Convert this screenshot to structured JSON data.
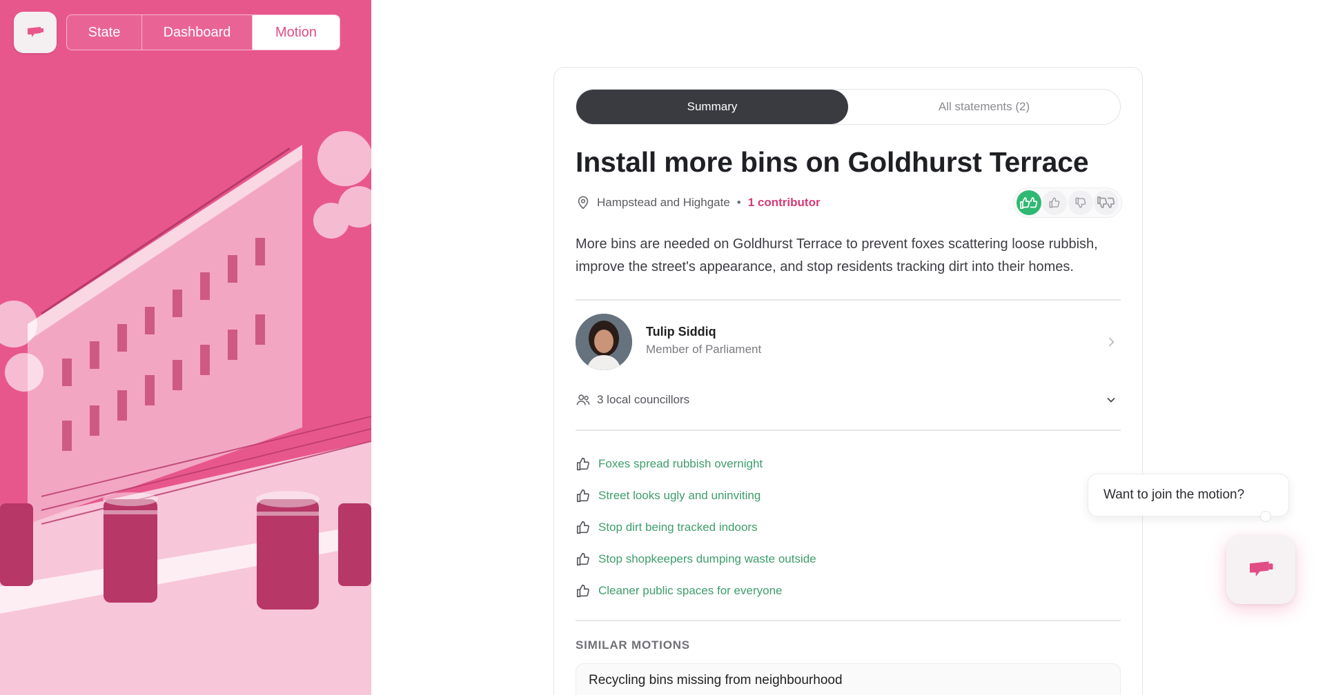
{
  "app": {
    "logo_icon": "flag-megaphone-icon",
    "accent": "#e8578c",
    "accent_dark": "#d63a77",
    "success": "#2fb872"
  },
  "nav": {
    "tabs": [
      {
        "label": "State"
      },
      {
        "label": "Dashboard"
      },
      {
        "label": "Motion",
        "active": true
      }
    ]
  },
  "segment": {
    "summary": "Summary",
    "all_statements": "All statements (2)",
    "active": "Summary"
  },
  "motion": {
    "title": "Install more bins on Goldhurst Terrace",
    "location": "Hampstead and Highgate",
    "separator": "•",
    "contributors": "1 contributor",
    "description": "More bins are needed on Goldhurst Terrace to prevent foxes scattering loose rubbish, improve the street's appearance, and stop residents tracking dirt into their homes.",
    "votes": [
      {
        "icon": "double-thumbs-up-icon",
        "selected": true
      },
      {
        "icon": "thumbs-up-icon",
        "selected": false
      },
      {
        "icon": "thumbs-down-icon",
        "selected": false
      },
      {
        "icon": "double-thumbs-down-icon",
        "selected": false
      }
    ]
  },
  "representative": {
    "name": "Tulip Siddiq",
    "role": "Member of Parliament"
  },
  "councillors": {
    "label": "3 local councillors"
  },
  "reasons": [
    "Foxes spread rubbish overnight",
    "Street looks ugly and uninviting",
    "Stop dirt being tracked indoors",
    "Stop shopkeepers dumping waste outside",
    "Cleaner public spaces for everyone"
  ],
  "similar": {
    "heading": "SIMILAR MOTIONS",
    "items": [
      {
        "title": "Recycling bins missing from neighbourhood"
      }
    ]
  },
  "join": {
    "prompt": "Want to join the motion?"
  }
}
